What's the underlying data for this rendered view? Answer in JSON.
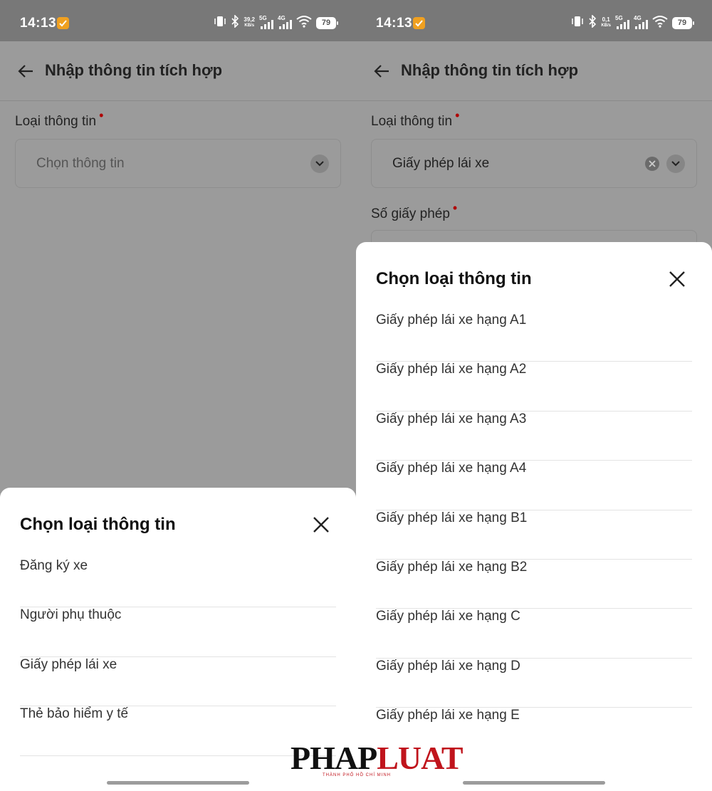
{
  "status_left": {
    "time": "14:13",
    "speed_top": "39,2",
    "speed_unit": "KB/s",
    "net_a": "5G",
    "net_b": "4G",
    "battery": "79"
  },
  "status_right": {
    "time": "14:13",
    "speed_top": "0,1",
    "speed_unit": "KB/s",
    "net_a": "5G",
    "net_b": "4G",
    "battery": "79"
  },
  "left": {
    "page_title": "Nhập thông tin tích hợp",
    "field_label": "Loại thông tin",
    "required_mark": "•",
    "select_placeholder": "Chọn thông tin",
    "sheet": {
      "title": "Chọn loại thông tin",
      "options": [
        "Đăng ký xe",
        "Người phụ thuộc",
        "Giấy phép lái xe",
        "Thẻ bảo hiểm y tế"
      ]
    }
  },
  "right": {
    "page_title": "Nhập thông tin tích hợp",
    "field_label": "Loại thông tin",
    "required_mark": "•",
    "select_value": "Giấy phép lái xe",
    "field2_label": "Số giấy phép",
    "sheet": {
      "title": "Chọn loại thông tin",
      "options": [
        "Giấy phép lái xe hạng A1",
        "Giấy phép lái xe hạng A2",
        "Giấy phép lái xe hạng A3",
        "Giấy phép lái xe hạng A4",
        "Giấy phép lái xe hạng B1",
        "Giấy phép lái xe hạng B2",
        "Giấy phép lái xe hạng C",
        "Giấy phép lái xe hạng D",
        "Giấy phép lái xe hạng E"
      ]
    }
  },
  "watermark": {
    "brand_a": "PHAP",
    "brand_b": "LUAT",
    "tagline": "THÀNH PHỐ HỒ CHÍ MINH"
  },
  "colors": {
    "scrim": "#9b9b9b",
    "statusbar": "#787878",
    "required": "#b00000",
    "sheet": "#ffffff",
    "brand_red": "#c0141c"
  }
}
